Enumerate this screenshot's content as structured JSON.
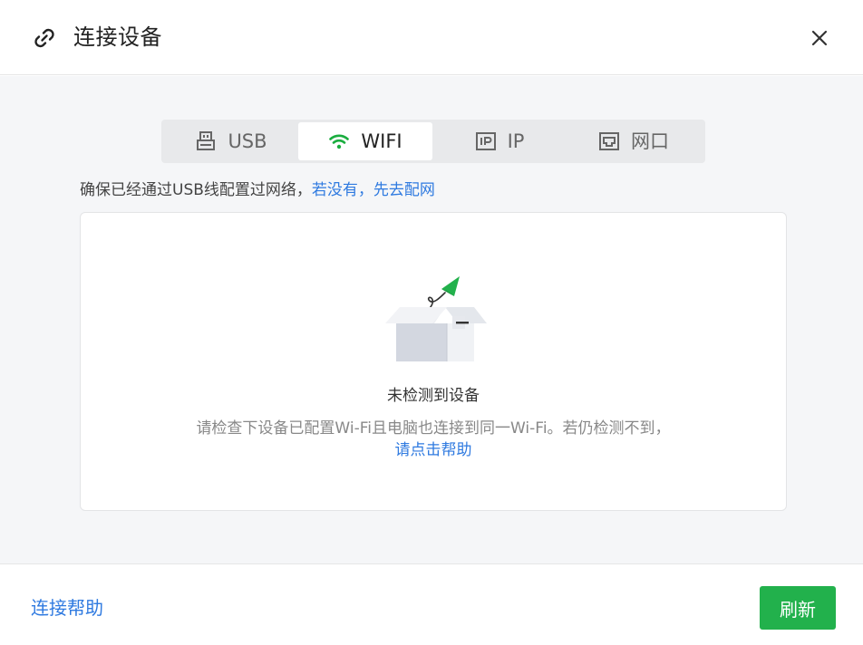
{
  "header": {
    "title": "连接设备",
    "icon": "link-icon",
    "close_icon": "close-icon"
  },
  "tabs": [
    {
      "label": "USB",
      "icon": "usb-icon",
      "active": false
    },
    {
      "label": "WIFI",
      "icon": "wifi-icon",
      "active": true
    },
    {
      "label": "IP",
      "icon": "ip-icon",
      "active": false
    },
    {
      "label": "网口",
      "icon": "ethernet-port-icon",
      "active": false
    }
  ],
  "hint": {
    "text": "确保已经通过USB线配置过网络，",
    "link": "若没有，先去配网"
  },
  "empty_state": {
    "illustration": "empty-box-icon",
    "title": "未检测到设备",
    "description": "请检查下设备已配置Wi-Fi且电脑也连接到同一Wi-Fi。若仍检测不到，",
    "help_link": "请点击帮助"
  },
  "footer": {
    "help_link": "连接帮助",
    "refresh_label": "刷新"
  },
  "colors": {
    "accent_green": "#22b14c",
    "link_blue": "#2f7ae0",
    "wifi_green": "#1aad3f"
  }
}
